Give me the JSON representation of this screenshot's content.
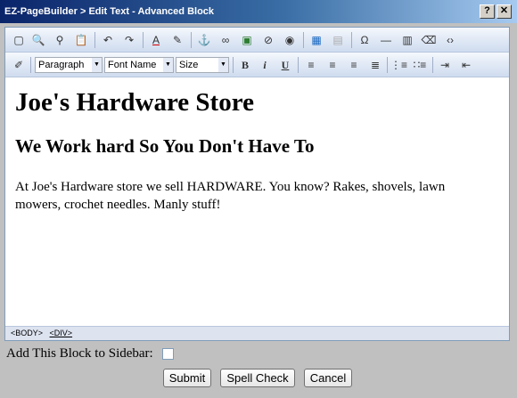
{
  "window": {
    "title": "EZ-PageBuilder > Edit Text - Advanced Block",
    "help_label": "?",
    "close_label": "✕"
  },
  "toolbar": {
    "paragraph_select": "Paragraph",
    "font_select": "Font Name",
    "size_select": "Size",
    "bold_label": "B",
    "italic_label": "i",
    "underline_label": "U"
  },
  "content": {
    "heading1": "Joe's Hardware Store",
    "heading2": "We Work hard So You Don't Have To",
    "paragraph": "At Joe's Hardware store we sell HARDWARE.  You know?  Rakes, shovels, lawn mowers, crochet needles. Manly stuff!"
  },
  "pathbar": {
    "body": "<BODY>",
    "div": "<DIV>"
  },
  "form": {
    "sidebar_label": "Add This Block to Sidebar:",
    "submit_label": "Submit",
    "spellcheck_label": "Spell Check",
    "cancel_label": "Cancel"
  }
}
